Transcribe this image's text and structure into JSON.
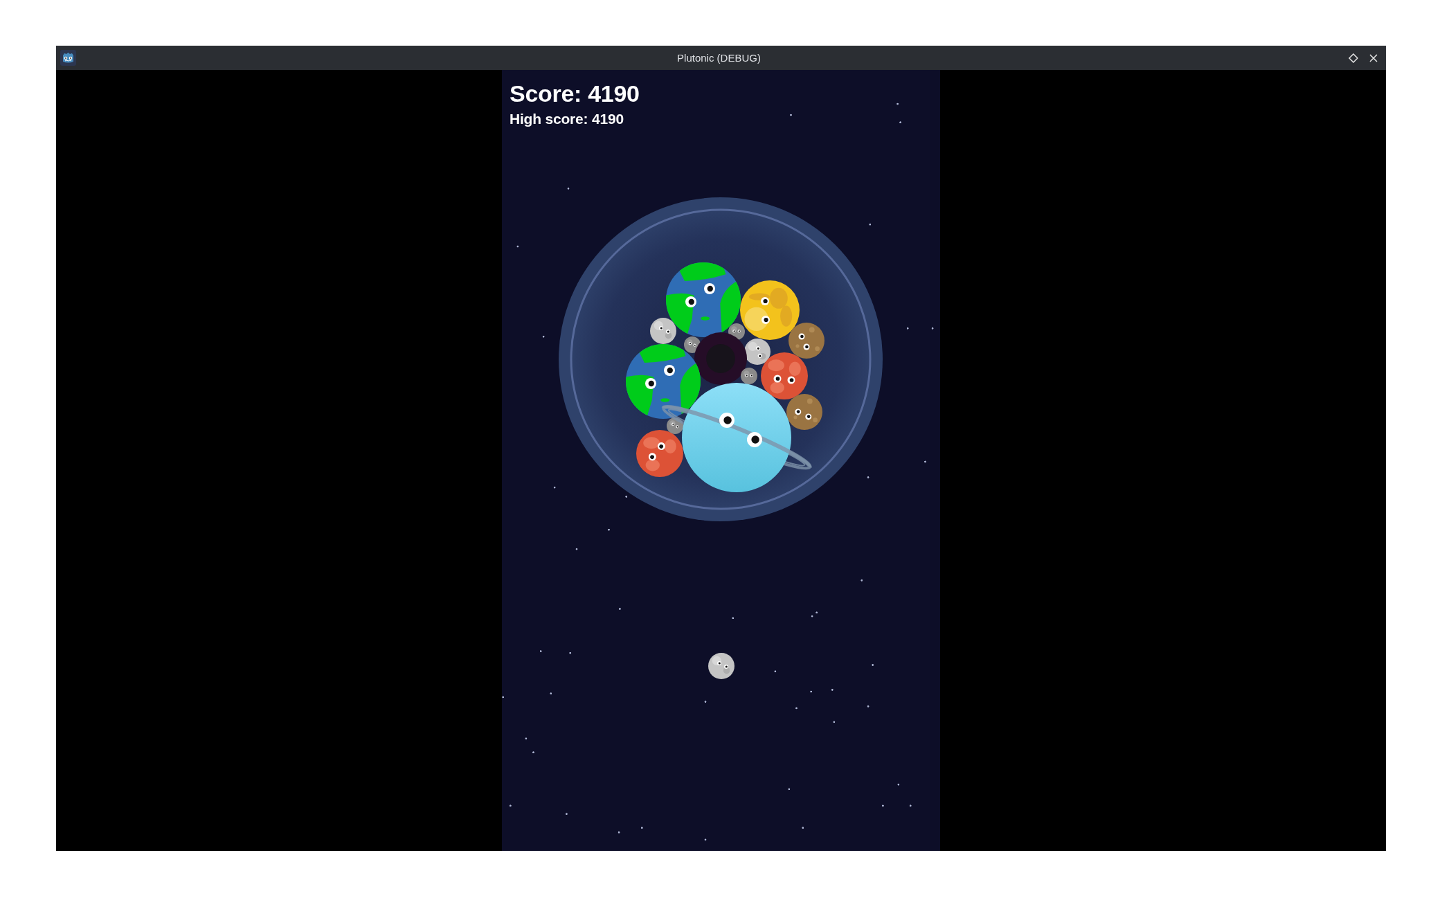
{
  "window": {
    "title": "Plutonic (DEBUG)"
  },
  "hud": {
    "score": "Score: 4190",
    "high_score": "High score: 4190"
  },
  "playfield": {
    "bodies": [
      {
        "kind": "earth"
      },
      {
        "kind": "venus"
      },
      {
        "kind": "moon"
      },
      {
        "kind": "pebble"
      },
      {
        "kind": "mercury"
      },
      {
        "kind": "pebble"
      },
      {
        "kind": "moon"
      },
      {
        "kind": "blackhole"
      },
      {
        "kind": "pebble"
      },
      {
        "kind": "mars"
      },
      {
        "kind": "earth"
      },
      {
        "kind": "mercury"
      },
      {
        "kind": "pebble"
      },
      {
        "kind": "uranus"
      },
      {
        "kind": "mars"
      }
    ],
    "next_body": {
      "kind": "moon"
    }
  }
}
